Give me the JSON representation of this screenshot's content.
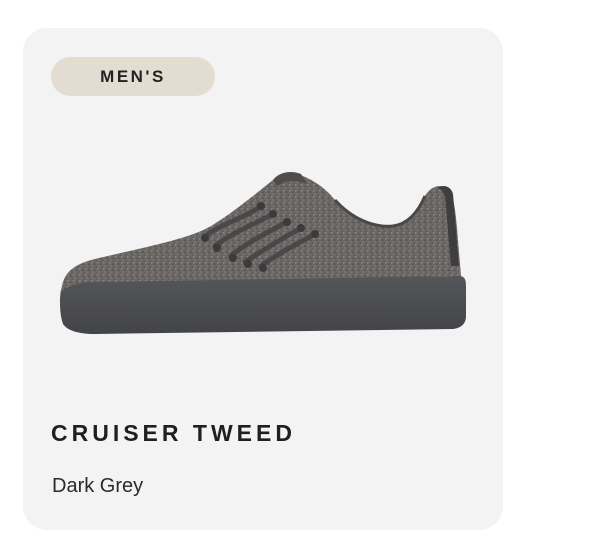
{
  "card": {
    "badge": "MEN'S",
    "product_name": "CRUISER TWEED",
    "color_name": "Dark Grey",
    "image": "grey-wool-sneaker-image"
  },
  "colors": {
    "card_background": "#f3f3f3",
    "badge_background": "#e3ddd1",
    "text": "#1f1f1f",
    "shoe_upper": "#6a6663",
    "shoe_sole": "#4b4c4f"
  }
}
